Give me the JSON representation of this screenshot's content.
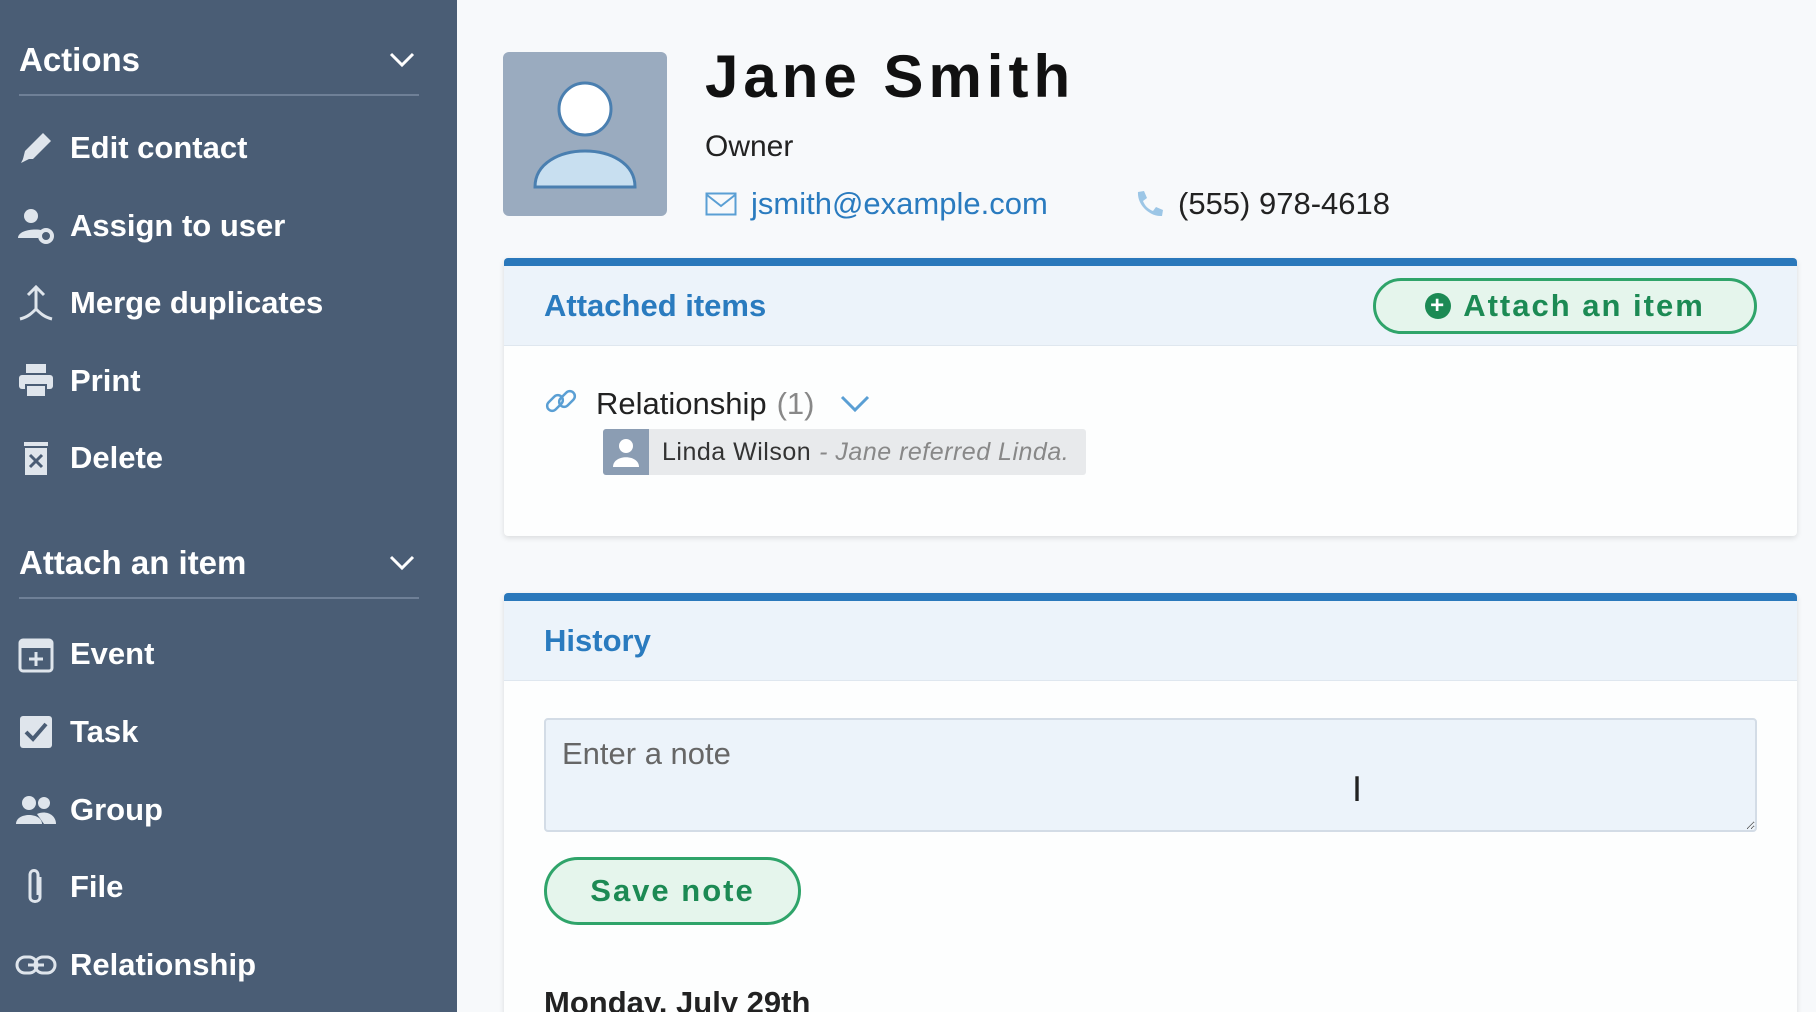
{
  "sidebar": {
    "actions": {
      "title": "Actions",
      "items": [
        {
          "label": "Edit contact",
          "icon": "pencil-icon"
        },
        {
          "label": "Assign to user",
          "icon": "user-gear-icon"
        },
        {
          "label": "Merge duplicates",
          "icon": "merge-icon"
        },
        {
          "label": "Print",
          "icon": "printer-icon"
        },
        {
          "label": "Delete",
          "icon": "trash-icon"
        }
      ]
    },
    "attach": {
      "title": "Attach an item",
      "items": [
        {
          "label": "Event",
          "icon": "calendar-plus-icon"
        },
        {
          "label": "Task",
          "icon": "checkbox-icon"
        },
        {
          "label": "Group",
          "icon": "group-icon"
        },
        {
          "label": "File",
          "icon": "paperclip-icon"
        },
        {
          "label": "Relationship",
          "icon": "link-icon"
        }
      ]
    }
  },
  "contact": {
    "name": "Jane Smith",
    "role": "Owner",
    "email": "jsmith@example.com",
    "phone": "(555) 978-4618"
  },
  "attached": {
    "title": "Attached items",
    "button_label": "Attach an item",
    "relationship": {
      "label": "Relationship",
      "count": "(1)",
      "item_name": "Linda Wilson",
      "item_note": "- Jane referred Linda."
    }
  },
  "history": {
    "title": "History",
    "note_placeholder": "Enter a note",
    "save_label": "Save note",
    "first_date": "Monday, July 29th"
  },
  "colors": {
    "sidebar_bg": "#4a5d75",
    "accent_blue": "#2a78bb",
    "accent_green": "#2fa46a"
  }
}
